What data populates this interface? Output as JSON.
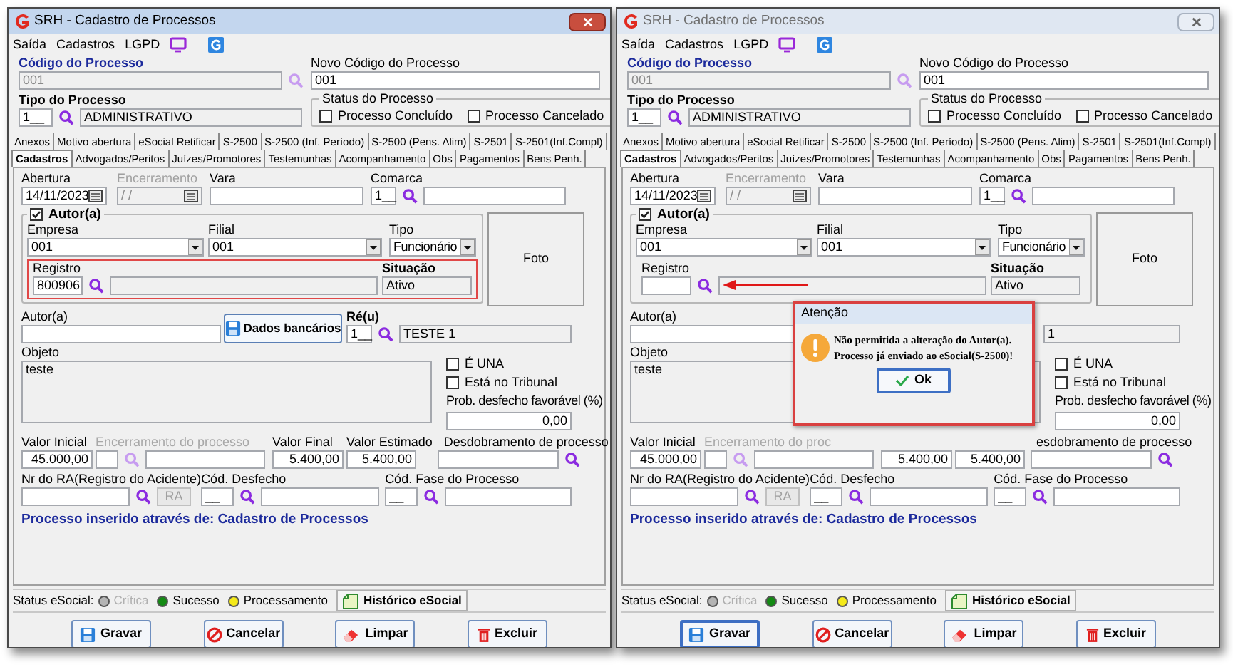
{
  "windows": [
    {
      "title": "SRH - Cadastro de Processos",
      "active": true,
      "menu": [
        "Saída",
        "Cadastros",
        "LGPD"
      ],
      "codigo": {
        "label": "Código do Processo",
        "value": "001",
        "disabled": true
      },
      "novo_codigo": {
        "label": "Novo Código do Processo",
        "value": "001"
      },
      "tipo": {
        "label": "Tipo do Processo",
        "code": "1__",
        "value": "ADMINISTRATIVO"
      },
      "status_processo": {
        "title": "Status do Processo",
        "options": [
          {
            "label": "Processo Concluído",
            "checked": false
          },
          {
            "label": "Processo Cancelado",
            "checked": false
          }
        ]
      },
      "tabs_row_1": [
        {
          "label": "Anexos",
          "selected": false
        },
        {
          "label": "Motivo abertura",
          "selected": false
        },
        {
          "label": "eSocial Retificar",
          "selected": false
        },
        {
          "label": "S-2500",
          "selected": false
        },
        {
          "label": "S-2500 (Inf. Período)",
          "selected": false
        },
        {
          "label": "S-2500 (Pens. Alim)",
          "selected": false
        },
        {
          "label": "S-2501",
          "selected": false
        },
        {
          "label": "S-2501(Inf.Compl)",
          "selected": false
        }
      ],
      "tabs_row_2": [
        {
          "label": "Cadastros",
          "selected": true
        },
        {
          "label": "Advogados/Peritos",
          "selected": false
        },
        {
          "label": "Juízes/Promotores",
          "selected": false
        },
        {
          "label": "Testemunhas",
          "selected": false
        },
        {
          "label": "Acompanhamento",
          "selected": false
        },
        {
          "label": "Obs",
          "selected": false
        },
        {
          "label": "Pagamentos",
          "selected": false
        },
        {
          "label": "Bens Penh.",
          "selected": false
        }
      ],
      "abertura": {
        "label": "Abertura",
        "value": "14/11/2023"
      },
      "encerramento": {
        "label": "Encerramento",
        "value": "/ /",
        "disabled": true
      },
      "vara": {
        "label": "Vara"
      },
      "comarca": {
        "label": "Comarca",
        "code": "1__"
      },
      "autor_group": {
        "title": "Autor(a)",
        "checked": true,
        "empresa": {
          "label": "Empresa",
          "value": "001"
        },
        "filial": {
          "label": "Filial",
          "value": "001"
        },
        "tipo": {
          "label": "Tipo",
          "value": "Funcionário"
        },
        "registro": {
          "label": "Registro",
          "value": "800906"
        },
        "situacao": {
          "label": "Situação",
          "value": "Ativo"
        },
        "highlighted": true,
        "arrow": false
      },
      "foto": "Foto",
      "autor": {
        "label": "Autor(a)"
      },
      "dados_bancarios": "Dados bancários",
      "reu": {
        "label": "Ré(u)",
        "code": "1__",
        "value": "TESTE 1"
      },
      "objeto": {
        "label": "Objeto",
        "value": "teste"
      },
      "flags": [
        {
          "label": "É UNA",
          "checked": false
        },
        {
          "label": "Está no Tribunal",
          "checked": false
        }
      ],
      "prob": {
        "label": "Prob. desfecho favorável (%)",
        "value": "0,00"
      },
      "valor_inicial": {
        "label": "Valor Inicial",
        "value": "45.000,00"
      },
      "encerramento_processo": {
        "label": "Encerramento do processo"
      },
      "valor_final": {
        "label": "Valor Final",
        "value": "5.400,00"
      },
      "valor_estimado": {
        "label": "Valor Estimado",
        "value": "5.400,00"
      },
      "desdobramento": {
        "label": "Desdobramento de processo"
      },
      "ra": {
        "label": "Nr do RA(Registro do Acidente)",
        "button": "RA"
      },
      "cod_desfecho": {
        "label": "Cód. Desfecho",
        "code": "__"
      },
      "fase": {
        "label": "Cód. Fase do Processo",
        "code": "__"
      },
      "info": "Processo inserido através de: Cadastro de Processos",
      "status_esocial": {
        "label": "Status eSocial:",
        "legend": [
          {
            "label": "Crítica",
            "color": "#b4b4b4",
            "disabled": true
          },
          {
            "label": "Sucesso",
            "color": "#138a13",
            "disabled": false
          },
          {
            "label": "Processamento",
            "color": "#f5ea1a",
            "disabled": false
          }
        ],
        "history": "Histórico eSocial"
      },
      "buttons": [
        {
          "label": "Gravar",
          "kind": "save",
          "focused": false
        },
        {
          "label": "Cancelar",
          "kind": "cancel",
          "focused": false
        },
        {
          "label": "Limpar",
          "kind": "clear",
          "focused": false
        },
        {
          "label": "Excluir",
          "kind": "delete",
          "focused": false
        }
      ]
    },
    {
      "title": "SRH - Cadastro de Processos",
      "active": false,
      "menu": [
        "Saída",
        "Cadastros",
        "LGPD"
      ],
      "codigo": {
        "label": "Código do Processo",
        "value": "001",
        "disabled": true
      },
      "novo_codigo": {
        "label": "Novo Código do Processo",
        "value": "001"
      },
      "tipo": {
        "label": "Tipo do Processo",
        "code": "1__",
        "value": "ADMINISTRATIVO"
      },
      "status_processo": {
        "title": "Status do Processo",
        "options": [
          {
            "label": "Processo Concluído",
            "checked": false
          },
          {
            "label": "Processo Cancelado",
            "checked": false
          }
        ]
      },
      "tabs_row_1": [
        {
          "label": "Anexos",
          "selected": false
        },
        {
          "label": "Motivo abertura",
          "selected": false
        },
        {
          "label": "eSocial Retificar",
          "selected": false
        },
        {
          "label": "S-2500",
          "selected": false
        },
        {
          "label": "S-2500 (Inf. Período)",
          "selected": false
        },
        {
          "label": "S-2500 (Pens. Alim)",
          "selected": false
        },
        {
          "label": "S-2501",
          "selected": false
        },
        {
          "label": "S-2501(Inf.Compl)",
          "selected": false
        }
      ],
      "tabs_row_2": [
        {
          "label": "Cadastros",
          "selected": true
        },
        {
          "label": "Advogados/Peritos",
          "selected": false
        },
        {
          "label": "Juízes/Promotores",
          "selected": false
        },
        {
          "label": "Testemunhas",
          "selected": false
        },
        {
          "label": "Acompanhamento",
          "selected": false
        },
        {
          "label": "Obs",
          "selected": false
        },
        {
          "label": "Pagamentos",
          "selected": false
        },
        {
          "label": "Bens Penh.",
          "selected": false
        }
      ],
      "abertura": {
        "label": "Abertura",
        "value": "14/11/2023"
      },
      "encerramento": {
        "label": "Encerramento",
        "value": "/ /",
        "disabled": true
      },
      "vara": {
        "label": "Vara"
      },
      "comarca": {
        "label": "Comarca",
        "code": "1__"
      },
      "autor_group": {
        "title": "Autor(a)",
        "checked": true,
        "empresa": {
          "label": "Empresa",
          "value": "001"
        },
        "filial": {
          "label": "Filial",
          "value": "001"
        },
        "tipo": {
          "label": "Tipo",
          "value": "Funcionário"
        },
        "registro": {
          "label": "Registro"
        },
        "situacao": {
          "label": "Situação",
          "value": "Ativo"
        },
        "highlighted": false,
        "arrow": true
      },
      "foto": "Foto",
      "autor": {
        "label": "Autor(a)"
      },
      "reu": {
        "value": "1"
      },
      "objeto": {
        "label": "Objeto",
        "value": "teste"
      },
      "flags": [
        {
          "label": "É UNA",
          "checked": false
        },
        {
          "label": "Está no Tribunal",
          "checked": false
        }
      ],
      "prob": {
        "label": "Prob. desfecho favorável (%)",
        "value": "0,00"
      },
      "valor_inicial": {
        "label": "Valor Inicial",
        "value": "45.000,00"
      },
      "encerramento_processo": {
        "label": "Encerramento do proc"
      },
      "valor_final": {
        "value": "5.400,00"
      },
      "valor_estimado": {
        "value": "5.400,00"
      },
      "desdobramento": {
        "label": "esdobramento de processo"
      },
      "ra": {
        "label": "Nr do RA(Registro do Acidente)",
        "button": "RA"
      },
      "cod_desfecho": {
        "label": "Cód. Desfecho",
        "code": "__"
      },
      "fase": {
        "label": "Cód. Fase do Processo",
        "code": "__"
      },
      "info": "Processo inserido através de: Cadastro de Processos",
      "status_esocial": {
        "label": "Status eSocial:",
        "legend": [
          {
            "label": "Crítica",
            "color": "#b4b4b4",
            "disabled": true
          },
          {
            "label": "Sucesso",
            "color": "#138a13",
            "disabled": false
          },
          {
            "label": "Processamento",
            "color": "#f5ea1a",
            "disabled": false
          }
        ],
        "history": "Histórico eSocial"
      },
      "buttons": [
        {
          "label": "Gravar",
          "kind": "save",
          "focused": true
        },
        {
          "label": "Cancelar",
          "kind": "cancel",
          "focused": false
        },
        {
          "label": "Limpar",
          "kind": "clear",
          "focused": false
        },
        {
          "label": "Excluir",
          "kind": "delete",
          "focused": false
        }
      ],
      "dialog": {
        "title": "Atenção",
        "message": [
          "Não permitida a alteração do Autor(a).",
          "Processo já enviado ao eSocial(S-2500)!"
        ],
        "button": "Ok"
      }
    }
  ]
}
